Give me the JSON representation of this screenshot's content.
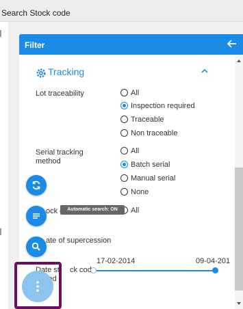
{
  "window": {
    "title": "Search Stock code"
  },
  "filter_panel": {
    "title": "Filter",
    "back_icon": "arrow-left-icon"
  },
  "tracking": {
    "title": "Tracking",
    "icon": "gear-icon",
    "collapse_icon": "chevron-up-icon",
    "lot_traceability": {
      "label": "Lot traceability",
      "options": [
        "All",
        "Inspection required",
        "Traceable",
        "Non traceable"
      ],
      "selected": "Inspection required"
    },
    "serial_tracking_method": {
      "label": "Serial tracking method",
      "options": [
        "All",
        "Batch serial",
        "Manual serial",
        "None"
      ],
      "selected": "Batch serial"
    },
    "stock_code_row": {
      "label_left": "S",
      "label_right": "ock c",
      "option": "All"
    },
    "date_of_supercession": {
      "label": "ate of supercession"
    },
    "date_stock_code_added": {
      "label_left": "Date st",
      "label_right": "ck code",
      "label_line2": "added",
      "start": "17-02-2014",
      "end": "09-04-201"
    }
  },
  "fabs": {
    "refresh_icon": "refresh-icon",
    "list_icon": "list-icon",
    "search_icon": "search-icon",
    "menu_icon": "more-vertical-icon",
    "tooltip": "Automatic search: ON"
  },
  "colors": {
    "accent": "#1a8be6",
    "header_text": "#ffffff",
    "tooltip_bg": "#666666",
    "highlight": "#6b0e5e"
  }
}
